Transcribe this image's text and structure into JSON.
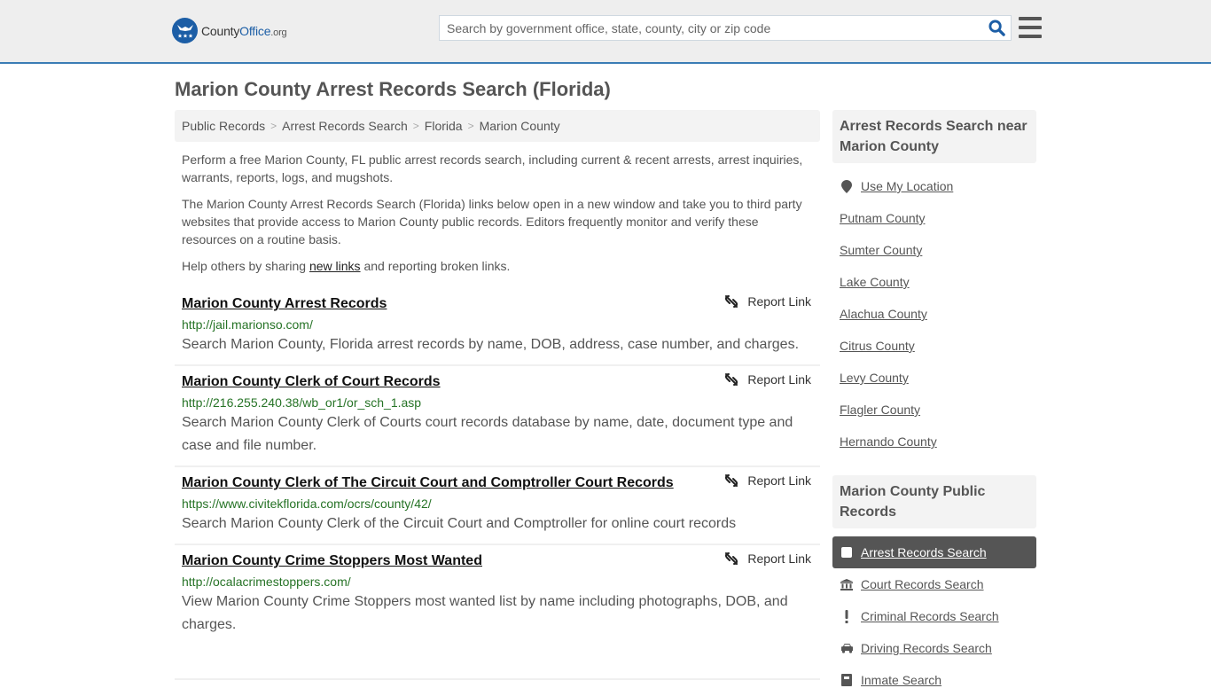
{
  "header": {
    "logo": {
      "name": "County",
      "name_accent": "Office",
      "tld": ".org"
    },
    "search": {
      "placeholder": "Search by government office, state, county, city or zip code",
      "value": ""
    },
    "icons": {
      "search": "search-icon",
      "menu": "hamburger-menu-icon"
    }
  },
  "page": {
    "title": "Marion County Arrest Records Search (Florida)"
  },
  "breadcrumb": [
    {
      "label": "Public Records"
    },
    {
      "label": "Arrest Records Search"
    },
    {
      "label": "Florida"
    },
    {
      "label": "Marion County"
    }
  ],
  "breadcrumb_separator": ">",
  "intro": {
    "p1": "Perform a free Marion County, FL public arrest records search, including current & recent arrests, arrest inquiries, warrants, reports, logs, and mugshots.",
    "p2": "The Marion County Arrest Records Search (Florida) links below open in a new window and take you to third party websites that provide access to Marion County public records. Editors frequently monitor and verify these resources on a routine basis.",
    "p3_before": "Help others by sharing ",
    "p3_link": "new links",
    "p3_after": " and reporting broken links."
  },
  "results": [
    {
      "title": "Marion County Arrest Records",
      "url": "http://jail.marionso.com/",
      "description": "Search Marion County, Florida arrest records by name, DOB, address, case number, and charges.",
      "report_label": "Report Link"
    },
    {
      "title": "Marion County Clerk of Court Records",
      "url": "http://216.255.240.38/wb_or1/or_sch_1.asp",
      "description": "Search Marion County Clerk of Courts court records database by name, date, document type and case and file number.",
      "report_label": "Report Link"
    },
    {
      "title": "Marion County Clerk of The Circuit Court and Comptroller Court Records",
      "url": "https://www.civitekflorida.com/ocrs/county/42/",
      "description": "Search Marion County Clerk of the Circuit Court and Comptroller for online court records",
      "report_label": "Report Link"
    },
    {
      "title": "Marion County Crime Stoppers Most Wanted",
      "url": "http://ocalacrimestoppers.com/",
      "description": "View Marion County Crime Stoppers most wanted list by name including photographs, DOB, and charges.",
      "report_label": "Report Link"
    }
  ],
  "sidebar": {
    "nearby": {
      "heading": "Arrest Records Search near Marion County",
      "use_location": "Use My Location",
      "counties": [
        "Putnam County",
        "Sumter County",
        "Lake County",
        "Alachua County",
        "Citrus County",
        "Levy County",
        "Flagler County",
        "Hernando County"
      ]
    },
    "public_records": {
      "heading": "Marion County Public Records",
      "items": [
        {
          "label": "Arrest Records Search",
          "icon": "square-icon",
          "active": true
        },
        {
          "label": "Court Records Search",
          "icon": "courthouse-icon",
          "active": false
        },
        {
          "label": "Criminal Records Search",
          "icon": "exclamation-icon",
          "active": false
        },
        {
          "label": "Driving Records Search",
          "icon": "car-icon",
          "active": false
        },
        {
          "label": "Inmate Search",
          "icon": "inmate-icon",
          "active": false
        }
      ]
    }
  },
  "colors": {
    "brand_blue": "#1c5ea6",
    "header_rule": "#3a7db5",
    "url_green": "#267326",
    "active_item_bg": "#555555"
  }
}
